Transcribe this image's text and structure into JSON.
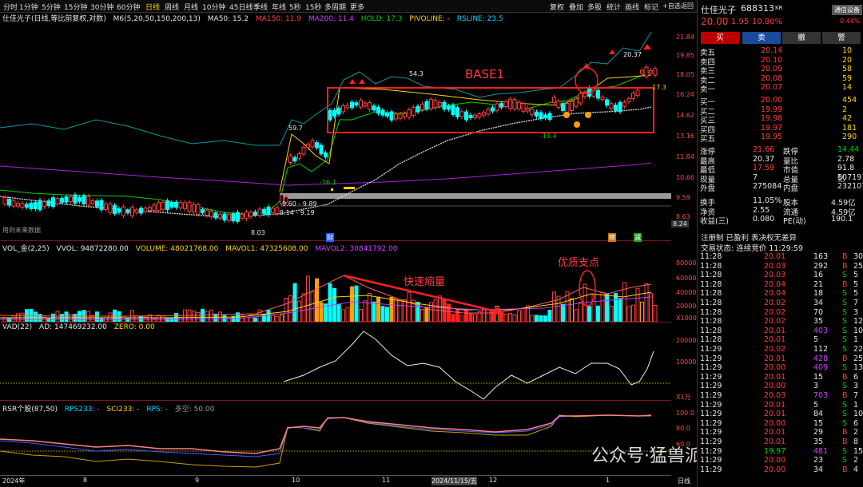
{
  "toolbar": {
    "periods": [
      "分时",
      "1分钟",
      "5分钟",
      "15分钟",
      "30分钟",
      "60分钟",
      "日线",
      "周线",
      "月线",
      "10分钟",
      "45日线",
      "季线",
      "年线",
      "5秒",
      "15秒",
      "多周期",
      "更多"
    ],
    "right": [
      "复权",
      "叠加",
      "多股",
      "统计",
      "画线",
      "标记",
      "+自选",
      "返回"
    ],
    "close_icon": "⊗"
  },
  "main": {
    "title": "仕佳光子(日线,等比前复权,对数)",
    "ma": "M6(5,20,50,150,200,13)",
    "ma50": "MA50: 15.2",
    "ma150": "MA150: 11.9",
    "ma200": "MA200: 11.4",
    "hold": "HOLD: 17.3",
    "pivot": "PIVOLINE: -",
    "rsline": "RSLINE: 23.5",
    "y_labels": [
      "21.84",
      "19.85",
      "18.05",
      "16.24",
      "14.62",
      "13.16",
      "11.84",
      "10.66",
      "9.59",
      "8.63",
      "8.24"
    ],
    "annotations": {
      "base": "BASE1",
      "p543": "54.3",
      "p597": "59.7",
      "p2037": "20.37",
      "p173": "17.3",
      "m161": "-16.1",
      "m194": "-19.4",
      "range": "9.60 - 9.89",
      "low": "8.14 - 9.19",
      "p803": "8.03",
      "note": "用到未来数据",
      "cai": "财",
      "div1": "榜",
      "div2": "减"
    }
  },
  "vol": {
    "title": "VOL_金(2,25)",
    "vvol": "VVOL: 94872280.00",
    "volume": "VOLUME: 48021768.00",
    "mavol1": "MAVOL1: 47325608.00",
    "mavol2": "MAVOL2: 30841792.00",
    "y_labels": [
      "80000",
      "60000",
      "40000",
      "20000",
      "X1000"
    ],
    "note1": "快速缩量",
    "note2": "优质支点"
  },
  "vad": {
    "title": "VAD(22)",
    "ad": "AD: 147469232.00",
    "zero": "ZERO: 0.00",
    "y_labels": [
      "20000",
      "10000",
      "X1万"
    ]
  },
  "rsr": {
    "title": "RSR个股(87,50)",
    "rps233": "RPS233: -",
    "sci233": "SCI233: -",
    "rps": "RPS: -",
    "duokong": "多空: 50.00",
    "y_labels": [
      "100.0",
      "80.0",
      "60.0"
    ]
  },
  "xaxis": [
    "2024年",
    "8",
    "9",
    "10",
    "11",
    "2024/11/15/五",
    "12",
    "1",
    "日线"
  ],
  "watermark": "公众号·猛兽派选股",
  "quote": {
    "name": "仕佳光子",
    "code": "688313",
    "tag": "KR",
    "badge": "通信设备",
    "badge2": "0.44%",
    "price": "20.00",
    "chg": "1.95",
    "pct": "10.80%",
    "buttons": [
      "买",
      "卖",
      "撤",
      "警"
    ],
    "asks": [
      [
        "卖五",
        "20.14",
        "10"
      ],
      [
        "卖四",
        "20.10",
        "20"
      ],
      [
        "卖三",
        "20.09",
        "58"
      ],
      [
        "卖二",
        "20.08",
        "59"
      ],
      [
        "卖一",
        "20.07",
        "14"
      ]
    ],
    "bids": [
      [
        "买一",
        "20.00",
        "454"
      ],
      [
        "买二",
        "19.99",
        "2"
      ],
      [
        "买三",
        "19.98",
        "42"
      ],
      [
        "买四",
        "19.97",
        "181"
      ],
      [
        "买五",
        "19.95",
        "290"
      ]
    ],
    "stats": [
      [
        "涨停",
        "21.66",
        "跌停",
        "14.44"
      ],
      [
        "最高",
        "20.37",
        "量比",
        "2.78"
      ],
      [
        "最低",
        "17.59",
        "市值",
        "91.8亿"
      ],
      [
        "现量",
        "7",
        "总量",
        "507191"
      ],
      [
        "外盘",
        "275084",
        "内盘",
        "232107"
      ]
    ],
    "stats2": [
      [
        "换手",
        "11.05%",
        "股本",
        "4.59亿"
      ],
      [
        "净资",
        "2.55",
        "流通",
        "4.59亿"
      ],
      [
        "收益(三)",
        "0.080",
        "PE(动)",
        "190.1"
      ]
    ],
    "reg": "注册制 已盈利 表决权无差异",
    "state": "交易状态: 连续竞价 11:29:59",
    "ticks": [
      [
        "11:28",
        "20.01",
        "163",
        "B",
        "30"
      ],
      [
        "11:28",
        "20.03",
        "292",
        "B",
        "25"
      ],
      [
        "11:28",
        "20.03",
        "16",
        "S",
        "5"
      ],
      [
        "11:28",
        "20.04",
        "21",
        "B",
        "5"
      ],
      [
        "11:28",
        "20.04",
        "18",
        "S",
        "5"
      ],
      [
        "11:28",
        "20.02",
        "34",
        "S",
        "7"
      ],
      [
        "11:28",
        "20.02",
        "70",
        "S",
        "3"
      ],
      [
        "11:28",
        "20.02",
        "35",
        "S",
        "12"
      ],
      [
        "11:28",
        "20.01",
        "403",
        "S",
        "10"
      ],
      [
        "11:28",
        "20.01",
        "5",
        "S",
        "1"
      ],
      [
        "11:29",
        "20.02",
        "112",
        "S",
        "22"
      ],
      [
        "11:29",
        "20.01",
        "428",
        "B",
        "25"
      ],
      [
        "11:29",
        "20.00",
        "409",
        "S",
        "13"
      ],
      [
        "11:29",
        "20.01",
        "15",
        "B",
        "6"
      ],
      [
        "11:29",
        "20.00",
        "3",
        "S",
        "3"
      ],
      [
        "11:29",
        "20.03",
        "703",
        "B",
        "7"
      ],
      [
        "11:29",
        "20.01",
        "5",
        "S",
        "1"
      ],
      [
        "11:29",
        "20.01",
        "84",
        "S",
        "10"
      ],
      [
        "11:29",
        "20.00",
        "15",
        "S",
        "6"
      ],
      [
        "11:29",
        "20.01",
        "29",
        "B",
        "2"
      ],
      [
        "11:29",
        "20.01",
        "35",
        "B",
        "8"
      ],
      [
        "11:29",
        "19.97",
        "481",
        "S",
        "15"
      ],
      [
        "11:29",
        "20.00",
        "23",
        "S",
        "2"
      ],
      [
        "11:29",
        "20.00",
        "34",
        "B",
        "4"
      ]
    ]
  },
  "colors": {
    "up": "#ff3c3c",
    "down": "#00ffff",
    "ma_yellow": "#ffd400",
    "ma_green": "#00d000",
    "ma_purple": "#b020e0",
    "ma_teal": "#0a9aa0"
  }
}
